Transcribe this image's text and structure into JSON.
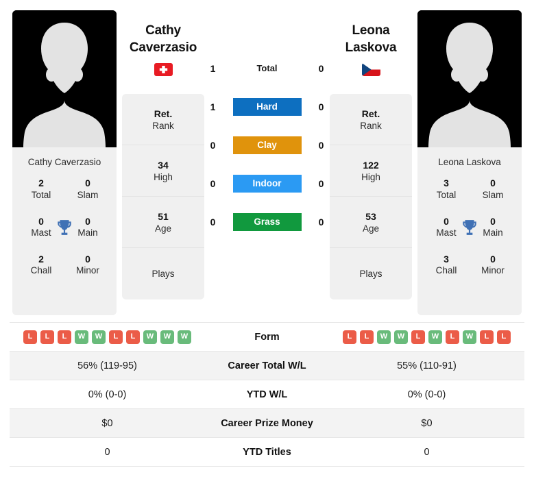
{
  "players": {
    "left": {
      "name_line1": "Cathy",
      "name_line2": "Caverzasio",
      "full_name": "Cathy Caverzasio",
      "flag": "switzerland-flag",
      "rank": "Ret.",
      "rank_label": "Rank",
      "high": "34",
      "high_label": "High",
      "age": "51",
      "age_label": "Age",
      "plays": "",
      "plays_label": "Plays",
      "trophies": {
        "total": "2",
        "total_label": "Total",
        "slam": "0",
        "slam_label": "Slam",
        "mast": "0",
        "mast_label": "Mast",
        "main": "0",
        "main_label": "Main",
        "chall": "2",
        "chall_label": "Chall",
        "minor": "0",
        "minor_label": "Minor"
      },
      "form": [
        "L",
        "L",
        "L",
        "W",
        "W",
        "L",
        "L",
        "W",
        "W",
        "W"
      ],
      "career_total_wl": "56% (119-95)",
      "ytd_wl": "0% (0-0)",
      "career_prize_money": "$0",
      "ytd_titles": "0"
    },
    "right": {
      "name_line1": "Leona",
      "name_line2": "Laskova",
      "full_name": "Leona Laskova",
      "flag": "czech-republic-flag",
      "rank": "Ret.",
      "rank_label": "Rank",
      "high": "122",
      "high_label": "High",
      "age": "53",
      "age_label": "Age",
      "plays": "",
      "plays_label": "Plays",
      "trophies": {
        "total": "3",
        "total_label": "Total",
        "slam": "0",
        "slam_label": "Slam",
        "mast": "0",
        "mast_label": "Mast",
        "main": "0",
        "main_label": "Main",
        "chall": "3",
        "chall_label": "Chall",
        "minor": "0",
        "minor_label": "Minor"
      },
      "form": [
        "L",
        "L",
        "W",
        "W",
        "L",
        "W",
        "L",
        "W",
        "L",
        "L"
      ],
      "career_total_wl": "55% (110-91)",
      "ytd_wl": "0% (0-0)",
      "career_prize_money": "$0",
      "ytd_titles": "0"
    }
  },
  "surfaces": [
    {
      "label": "Total",
      "left": "1",
      "right": "0",
      "color": ""
    },
    {
      "label": "Hard",
      "left": "1",
      "right": "0",
      "color": "#0d6fc0"
    },
    {
      "label": "Clay",
      "left": "0",
      "right": "0",
      "color": "#e0930c"
    },
    {
      "label": "Indoor",
      "left": "0",
      "right": "0",
      "color": "#2b9af3"
    },
    {
      "label": "Grass",
      "left": "0",
      "right": "0",
      "color": "#11993e"
    }
  ],
  "table_rows": [
    {
      "label": "Form",
      "left": "",
      "right": "",
      "type": "form"
    },
    {
      "label": "Career Total W/L",
      "left": "56% (119-95)",
      "right": "55% (110-91)",
      "type": "text"
    },
    {
      "label": "YTD W/L",
      "left": "0% (0-0)",
      "right": "0% (0-0)",
      "type": "text"
    },
    {
      "label": "Career Prize Money",
      "left": "$0",
      "right": "$0",
      "type": "text"
    },
    {
      "label": "YTD Titles",
      "left": "0",
      "right": "0",
      "type": "text"
    }
  ],
  "colors": {
    "win_badge": "#69bb7b",
    "loss_badge": "#eb5c48",
    "trophy": "#4071b5",
    "card_bg": "#f0f0f0",
    "row_alt_bg": "#f3f3f3"
  },
  "icons": {
    "trophy": "trophy-icon",
    "avatar": "player-avatar-placeholder"
  }
}
